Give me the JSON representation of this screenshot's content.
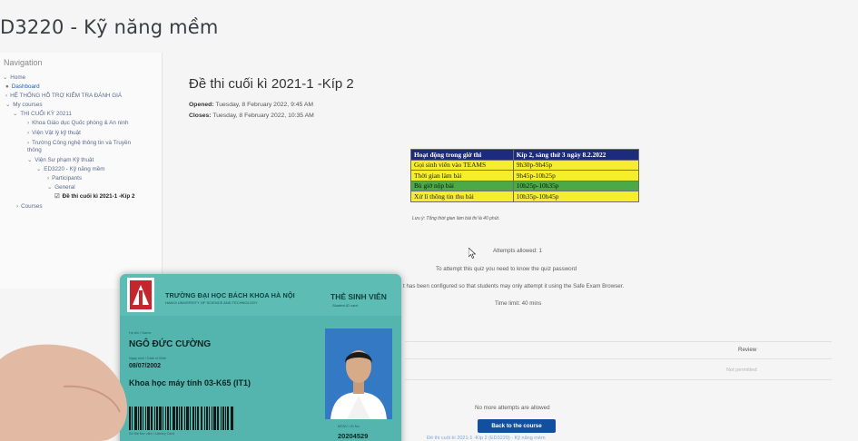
{
  "course": {
    "title": "D3220 - Kỹ năng mềm"
  },
  "nav": {
    "heading": "Navigation",
    "items": [
      {
        "label": "Home"
      },
      {
        "label": "Dashboard"
      },
      {
        "label": "HỆ THỐNG HỖ TRỢ KIỂM TRA ĐÁNH GIÁ"
      },
      {
        "label": "My courses"
      },
      {
        "label": "THI CUỐI KỲ 20211"
      },
      {
        "label": "Khoa Giáo dục Quốc phòng & An ninh"
      },
      {
        "label": "Viện Vật lý kỹ thuật"
      },
      {
        "label": "Trường Công nghệ thông tin và Truyền thông"
      },
      {
        "label": "Viện Sư phạm Kỹ thuật"
      },
      {
        "label": "ED3220 - Kỹ năng mềm"
      },
      {
        "label": "Participants"
      },
      {
        "label": "General"
      },
      {
        "label": "Đề thi cuối kì 2021-1 -Kíp 2"
      },
      {
        "label": "Courses"
      }
    ]
  },
  "quiz": {
    "title": "Đề thi cuối kì 2021-1 -Kíp 2",
    "opened_label": "Opened:",
    "opened_value": "Tuesday, 8 February 2022, 9:45 AM",
    "closes_label": "Closes:",
    "closes_value": "Tuesday, 8 February 2022, 10:35 AM",
    "schedule": {
      "header": [
        "Hoạt động trong giờ thi",
        "Kíp 2, sáng thứ 3 ngày 8.2.2022"
      ],
      "rows": [
        {
          "activity": "Gọi sinh viên vào TEAMS",
          "time": "9h30p-9h45p"
        },
        {
          "activity": "Thời gian làm bài",
          "time": "9h45p-10h25p"
        },
        {
          "activity": "Bù giờ nộp bài",
          "time": "10h25p-10h35p"
        },
        {
          "activity": "Xử lí thông tin thu bài",
          "time": "10h35p-10h45p"
        }
      ],
      "colors": {
        "header": "#1c2a80",
        "yellow": "#f6ed2c",
        "green": "#4ba948"
      }
    },
    "note": "Lưu ý: Tổng thời gian làm bài thi là 40 phút.",
    "attempts_allowed": "Attempts allowed: 1",
    "password_notice": "To attempt this quiz you need to know the quiz password",
    "seb_notice": "t has been configured so that students may only attempt it using the Safe Exam Browser.",
    "time_limit": "Time limit: 40 mins",
    "review_header": "Review",
    "review_value": "Not permitted",
    "no_more_attempts": "No more attempts are allowed",
    "back_button": "Back to the course",
    "footer_link": "Đề thi cuối kì 2021-1 -Kíp 2 (ED3220) - Kỹ năng mềm"
  },
  "card": {
    "university": "TRƯỜNG ĐẠI HỌC BÁCH KHOA HÀ NỘI",
    "university_en": "HANOI UNIVERSITY OF SCIENCE AND TECHNOLOGY",
    "card_type": "THẺ SINH VIÊN",
    "card_type_en": "Student ID card",
    "name_label": "Họ tên / Name",
    "name": "NGÔ ĐỨC CƯỜNG",
    "dob_label": "Ngày sinh / Date of Birth",
    "dob": "08/07/2002",
    "major": "Khoa học máy tính 03-K65 (IT1)",
    "barcode_label": "Số thẻ thư viện / Library Card",
    "id_label": "MSSV / ID No.",
    "student_id": "20204529"
  }
}
